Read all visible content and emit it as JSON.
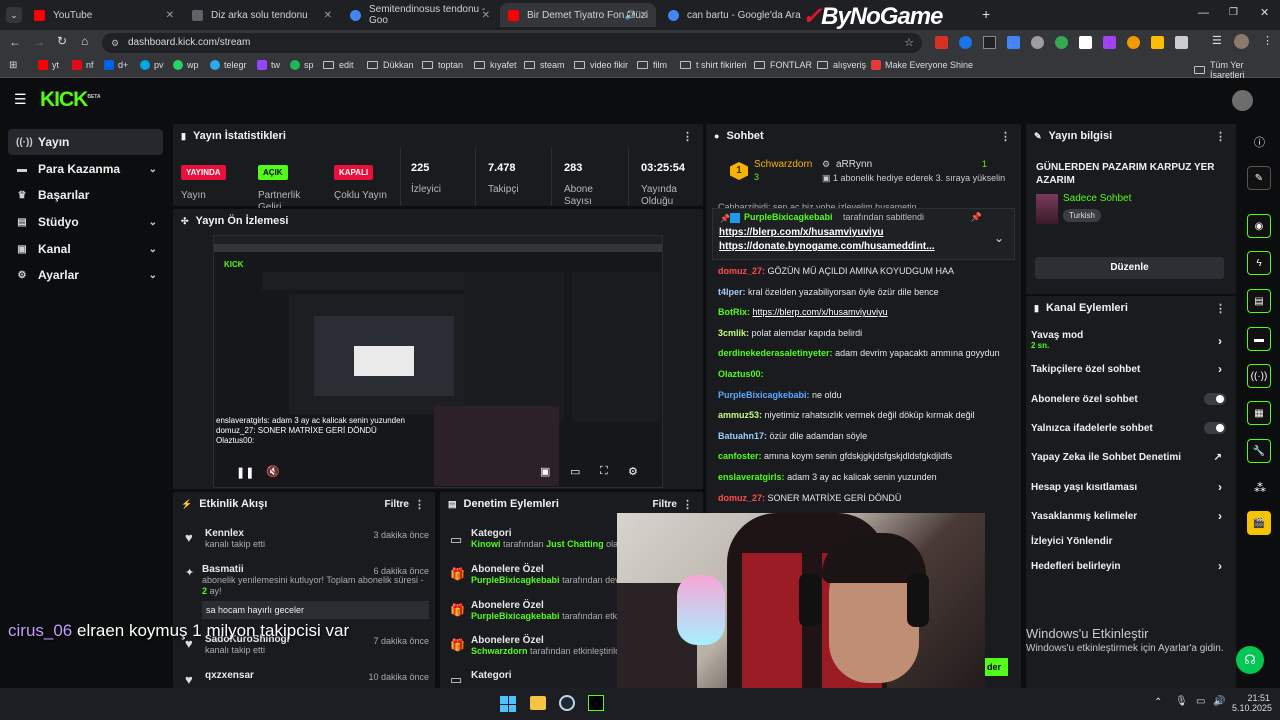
{
  "browser": {
    "tabs": [
      {
        "label": "YouTube",
        "color": "#ff0000"
      },
      {
        "label": "Diz arka solu tendonu",
        "color": "#5f6368"
      },
      {
        "label": "Semitendinosus tendonu - Goo",
        "color": "#4285f4"
      },
      {
        "label": "Bir Demet Tiyatro Fon Müzi",
        "color": "#ff0000"
      },
      {
        "label": "can bartu - Google'da Ara",
        "color": "#4285f4"
      }
    ],
    "url": "dashboard.kick.com/stream",
    "watermark": "ByNoGame",
    "bookmarks": [
      "yt",
      "nf",
      "d+",
      "pv",
      "wp",
      "telegr",
      "tw",
      "sp",
      "edit",
      "Dükkan",
      "toptan",
      "kıyafet",
      "steam",
      "video fikir",
      "film",
      "t shirt fikirleri",
      "FONTLAR",
      "alışveriş",
      "Make Everyone Shine"
    ],
    "all_bookmarks": "Tüm Yer İşaretleri"
  },
  "kick": {
    "logo": "KICK",
    "logo_sup": "BETA",
    "sidebar": [
      {
        "label": "Yayın",
        "icon": "broadcast-icon",
        "glyph": "((·))",
        "chevron": false
      },
      {
        "label": "Para Kazanma",
        "icon": "money-icon",
        "glyph": "▬",
        "chevron": true
      },
      {
        "label": "Başarılar",
        "icon": "trophy-icon",
        "glyph": "🏆",
        "chevron": false
      },
      {
        "label": "Stüdyo",
        "icon": "studio-icon",
        "glyph": "▤",
        "chevron": true
      },
      {
        "label": "Kanal",
        "icon": "channel-icon",
        "glyph": "▣",
        "chevron": true
      },
      {
        "label": "Ayarlar",
        "icon": "gear-icon",
        "glyph": "⚙",
        "chevron": true
      }
    ],
    "stats": {
      "title": "Yayın İstatistikleri",
      "items": [
        {
          "badge": "YAYINDA",
          "label": "Yayın"
        },
        {
          "badge": "AÇIK",
          "label": "Partnerlik Geliri"
        },
        {
          "badge": "KAPALI",
          "label": "Çoklu Yayın"
        },
        {
          "value": "225",
          "label": "İzleyici"
        },
        {
          "value": "7.478",
          "label": "Takipçi"
        },
        {
          "value": "283",
          "label": "Abone Sayısı"
        },
        {
          "value": "03:25:54",
          "label": "Yayında Olduğu"
        }
      ]
    },
    "preview": {
      "title": "Yayın Ön İzlemesi",
      "overlay_lines": [
        "enslaveratgirls: adam 3 ay ac kalicak senin yuzunden",
        "domuz_27: SONER MATRİXE GERİ DÖNDÜ",
        "Olaztus00:"
      ]
    },
    "activity": {
      "title": "Etkinlik Akışı",
      "filter": "Filtre",
      "items": [
        {
          "user": "Kennlex",
          "desc": "kanalı takip etti",
          "time": "3 dakika önce"
        },
        {
          "user": "Basmatii",
          "desc": "abonelik yenilemesini kutluyor! Toplam abonelik süresi -",
          "months": "2",
          "desc2": "ay!",
          "time": "6 dakika önce",
          "message": "sa hocam hayırlı geceler"
        },
        {
          "user": "SadoKuroShinogi",
          "desc": "kanalı takip etti",
          "time": "7 dakika önce"
        },
        {
          "user": "qxzxensar",
          "desc": "",
          "time": "10 dakika önce"
        }
      ]
    },
    "moderation": {
      "title": "Denetim Eylemleri",
      "filter": "Filtre",
      "items": [
        {
          "title": "Kategori",
          "by": "Kinowi",
          "text": "tarafından",
          "target": "Just Chatting",
          "tail": "olarak"
        },
        {
          "title": "Abonelere Özel",
          "by": "PurpleBixicagkebabi",
          "text": "tarafından devre"
        },
        {
          "title": "Abonelere Özel",
          "by": "PurpleBixicagkebabi",
          "text": "tarafından etkin"
        },
        {
          "title": "Abonelere Özel",
          "by": "Schwarzdorn",
          "text": "tarafından etkinleştirildi"
        },
        {
          "title": "Kategori",
          "by": "",
          "text": ""
        }
      ]
    },
    "chat": {
      "title": "Sohbet",
      "top_gifter": "Schwarzdorn",
      "top_rank": "1",
      "top_count": "3",
      "second_gifter": "aRRynn",
      "second_count": "1",
      "gift_note": "1 abonelik hediye ederek 3. sıraya yükselin",
      "pinned_by": "PurpleBixicagkebabi",
      "pinned_text": "tarafından sabitlendi",
      "pinned_links": [
        "https://blerp.com/x/husamviyuviyu",
        "https://donate.bynogame.com/husameddint..."
      ],
      "cut_top": "Cabbarzibidi: sen ac biz vohe izleyelim husametin",
      "messages": [
        {
          "user": "domuz_27",
          "color": "#ff4d4d",
          "text": "GÖZÜN MÜ AÇILDI AMINA KOYUDGUM HAA"
        },
        {
          "user": "t4lper",
          "color": "#a8c8ff",
          "text": "kral özelden yazabiliyorsan öyle özür dile bence"
        },
        {
          "user": "BotRix",
          "color": "#53fc18",
          "text": "https://blerp.com/x/husamviyuviyu",
          "link": true
        },
        {
          "user": "3cmlik",
          "color": "#c6ff7a",
          "text": "polat alemdar kapıda belirdi"
        },
        {
          "user": "derdinekederasaletinyeter",
          "color": "#53fc18",
          "text": "adam devrim yapacaktı ammına goyydun"
        },
        {
          "user": "Olaztus00",
          "color": "#53fc18",
          "text": ""
        },
        {
          "user": "PurpleBixicagkebabi",
          "color": "#5aa9ff",
          "text": "ne oldu"
        },
        {
          "user": "ammuz53",
          "color": "#c6ff7a",
          "text": "niyetimiz rahatsızlık vermek değil döküp kırmak değil"
        },
        {
          "user": "Batuahn17",
          "color": "#9ad0ff",
          "text": "özür dile adamdan söyle"
        },
        {
          "user": "canfoster",
          "color": "#53fc18",
          "text": "amına koym senin gfdskjgkjdsfgskjdldsfgkdjldfs"
        },
        {
          "user": "enslaveratgirls",
          "color": "#53fc18",
          "text": "adam 3 ay ac kalicak senin yuzunden"
        },
        {
          "user": "domuz_27",
          "color": "#ff4d4d",
          "text": "SONER MATRİXE GERİ DÖNDÜ"
        }
      ]
    },
    "stream_info": {
      "title": "Yayın bilgisi",
      "stream_title": "GÜNLERDEN PAZARIM KARPUZ YER AZARIM",
      "category": "Sadece Sohbet",
      "language": "Turkish",
      "edit_button": "Düzenle"
    },
    "channel_actions": {
      "title": "Kanal Eylemleri",
      "items": [
        {
          "label": "Yavaş mod",
          "sub": "2 sn.",
          "control": "chevron"
        },
        {
          "label": "Takipçilere özel sohbet",
          "control": "chevron"
        },
        {
          "label": "Abonelere özel sohbet",
          "control": "toggle"
        },
        {
          "label": "Yalnızca ifadelerle sohbet",
          "control": "toggle"
        },
        {
          "label": "Yapay Zeka ile Sohbet Denetimi",
          "control": "external"
        },
        {
          "label": "Hesap yaşı kısıtlaması",
          "control": "chevron"
        },
        {
          "label": "Yasaklanmış kelimeler",
          "control": "chevron"
        },
        {
          "label": "İzleyici Yönlendir",
          "control": "none"
        },
        {
          "label": "Hedefleri belirleyin",
          "control": "chevron"
        }
      ]
    },
    "send_button": "der"
  },
  "overlay": {
    "viewer_user": "cirus_06",
    "viewer_text": "elraen koymuş 1 milyon takipcisi var"
  },
  "windows": {
    "activate_title": "Windows'u Etkinleştir",
    "activate_sub": "Windows'u etkinleştirmek için Ayarlar'a gidin.",
    "time": "21:51",
    "date": "5.10.2025"
  },
  "colors": {
    "kick_green": "#53fc18",
    "live_red": "#e9113c"
  }
}
